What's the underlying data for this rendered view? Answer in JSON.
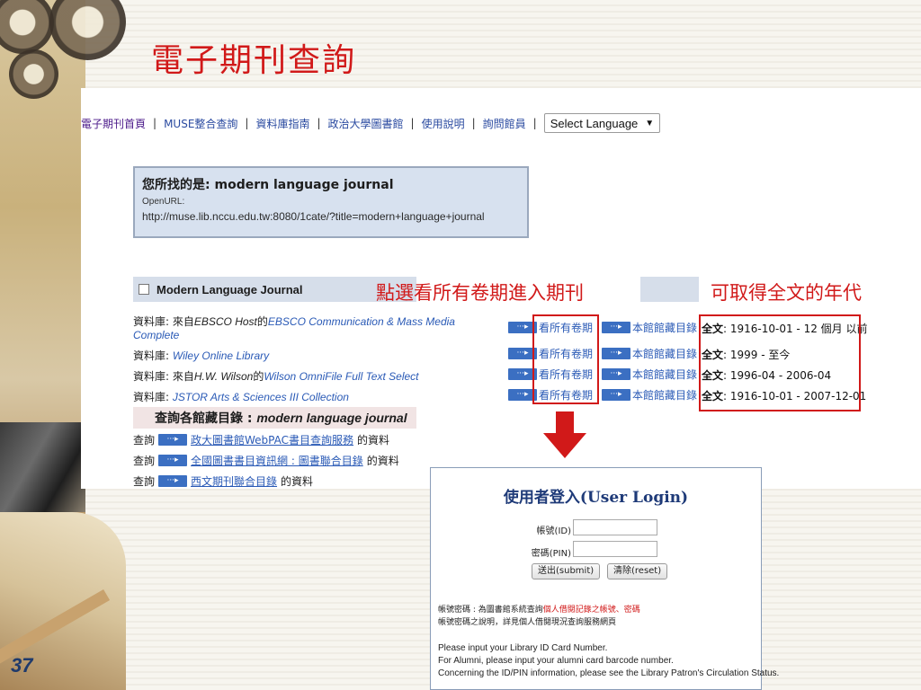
{
  "slide": {
    "title": "電子期刊查詢",
    "number": "37"
  },
  "nav": {
    "items": [
      "電子期刊首頁",
      "MUSE整合查詢",
      "資料庫指南",
      "政治大學圖書館",
      "使用說明",
      "詢問館員"
    ],
    "separator": "|",
    "language_select": "Select Language"
  },
  "search_summary": {
    "label": "您所找的是:",
    "query": "modern language journal",
    "openurl_label": "OpenURL:",
    "openurl": "http://muse.lib.nccu.edu.tw:8080/1cate/?title=modern+language+journal"
  },
  "journal": {
    "title": "Modern Language Journal"
  },
  "annotations": {
    "select_all_issues": "點選看所有卷期進入期刊",
    "fulltext_years": "可取得全文的年代"
  },
  "databases": [
    {
      "prefix": "資料庫: 來自",
      "vendor": "EBSCO Host",
      "mid": "的",
      "name": "EBSCO Communication & Mass Media",
      "name2": "Complete",
      "fulltext": "1916-10-01 - 12 個月 以前"
    },
    {
      "prefix": "資料庫: ",
      "vendor": "",
      "mid": "",
      "name": "Wiley Online Library",
      "name2": "",
      "fulltext": "1999 - 至今"
    },
    {
      "prefix": "資料庫: 來自",
      "vendor": "H.W. Wilson",
      "mid": "的",
      "name": "Wilson OmniFile Full Text Select",
      "name2": "",
      "fulltext": "1996-04 - 2006-04"
    },
    {
      "prefix": "資料庫: ",
      "vendor": "",
      "mid": "",
      "name": "JSTOR Arts & Sciences III Collection",
      "name2": "",
      "fulltext": "1916-10-01 - 2007-12-01"
    }
  ],
  "actions": {
    "all_issues": "看所有卷期",
    "library_catalog": "本館館藏目錄",
    "fulltext_label": "全文",
    "arrow": "···▸"
  },
  "catalog": {
    "title_prefix": "查詢各館藏目錄 : ",
    "title_query": "modern language journal",
    "rows": [
      {
        "prefix": "查詢",
        "link": "政大圖書館WebPAC書目查詢服務",
        "suffix": "的資料"
      },
      {
        "prefix": "查詢",
        "link": "全國圖書書目資訊網 : 圖書聯合目錄",
        "suffix": "的資料"
      },
      {
        "prefix": "查詢",
        "link": "西文期刊聯合目錄",
        "suffix": "的資料"
      }
    ]
  },
  "login": {
    "title": "使用者登入(User Login)",
    "id_label": "帳號(ID)",
    "pin_label": "密碼(PIN)",
    "submit": "送出(submit)",
    "reset": "清除(reset)",
    "note1_prefix": "帳號密碼 : 為圖書館系統查詢",
    "note1_red": "個人借閱記錄之帳號、密碼",
    "note2": "帳號密碼之說明，詳見個人借閱現況查詢服務網頁",
    "en1": "Please input your Library ID Card Number.",
    "en2": "For Alumni, please input your alumni card barcode number.",
    "en3": "Concerning the ID/PIN information, please see the Library Patron's Circulation Status."
  },
  "colors": {
    "accent_red": "#d11919",
    "link_blue": "#2a5ab6",
    "panel_blue": "#d6deea"
  }
}
